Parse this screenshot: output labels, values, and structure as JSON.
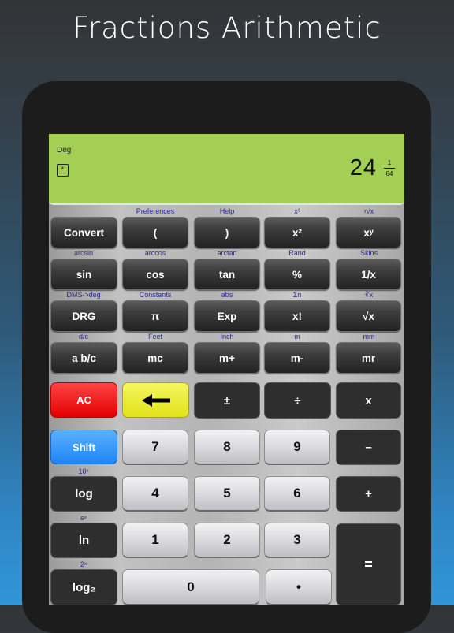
{
  "headline": "Fractions Arithmetic",
  "display": {
    "mode": "Deg",
    "memory_indicator": "*",
    "whole": "24",
    "numerator": "1",
    "denominator": "64",
    "background_color": "#a2cf54"
  },
  "sci_rows": [
    {
      "keys": [
        {
          "label": "Convert",
          "sub": ""
        },
        {
          "label": "(",
          "sub": "Preferences"
        },
        {
          "label": ")",
          "sub": "Help"
        },
        {
          "label": "x²",
          "sub": "x³"
        },
        {
          "label": "xʸ",
          "sub": "ʸ√x"
        }
      ]
    },
    {
      "keys": [
        {
          "label": "sin",
          "sub": "arcsin"
        },
        {
          "label": "cos",
          "sub": "arccos"
        },
        {
          "label": "tan",
          "sub": "arctan"
        },
        {
          "label": "%",
          "sub": "Rand"
        },
        {
          "label": "1/x",
          "sub": "Skins"
        }
      ]
    },
    {
      "keys": [
        {
          "label": "DRG",
          "sub": "DMS->deg"
        },
        {
          "label": "π",
          "sub": "Constants"
        },
        {
          "label": "Exp",
          "sub": "abs"
        },
        {
          "label": "x!",
          "sub": "Σn"
        },
        {
          "label": "√x",
          "sub": "∛x"
        }
      ]
    },
    {
      "keys": [
        {
          "label": "a b/c",
          "sub": "d/c"
        },
        {
          "label": "mc",
          "sub": "Feet"
        },
        {
          "label": "m+",
          "sub": "Inch"
        },
        {
          "label": "m-",
          "sub": "m"
        },
        {
          "label": "mr",
          "sub": "mm"
        }
      ]
    }
  ],
  "keys": {
    "ac": "AC",
    "backspace": "←",
    "plus_minus": "±",
    "divide": "÷",
    "multiply": "x",
    "shift": "Shift",
    "seven": "7",
    "eight": "8",
    "nine": "9",
    "minus": "–",
    "log": "log",
    "log_sub": "10ˣ",
    "four": "4",
    "five": "5",
    "six": "6",
    "plus": "+",
    "ln": "ln",
    "ln_sub": "eˣ",
    "one": "1",
    "two": "2",
    "three": "3",
    "equals": "=",
    "log2": "log₂",
    "log2_sub": "2ˣ",
    "zero": "0",
    "decimal": "•"
  },
  "colors": {
    "ac": "#e20000",
    "backspace": "#e3e31a",
    "shift": "#1e86f5",
    "sublabel": "#2c2a8a"
  }
}
